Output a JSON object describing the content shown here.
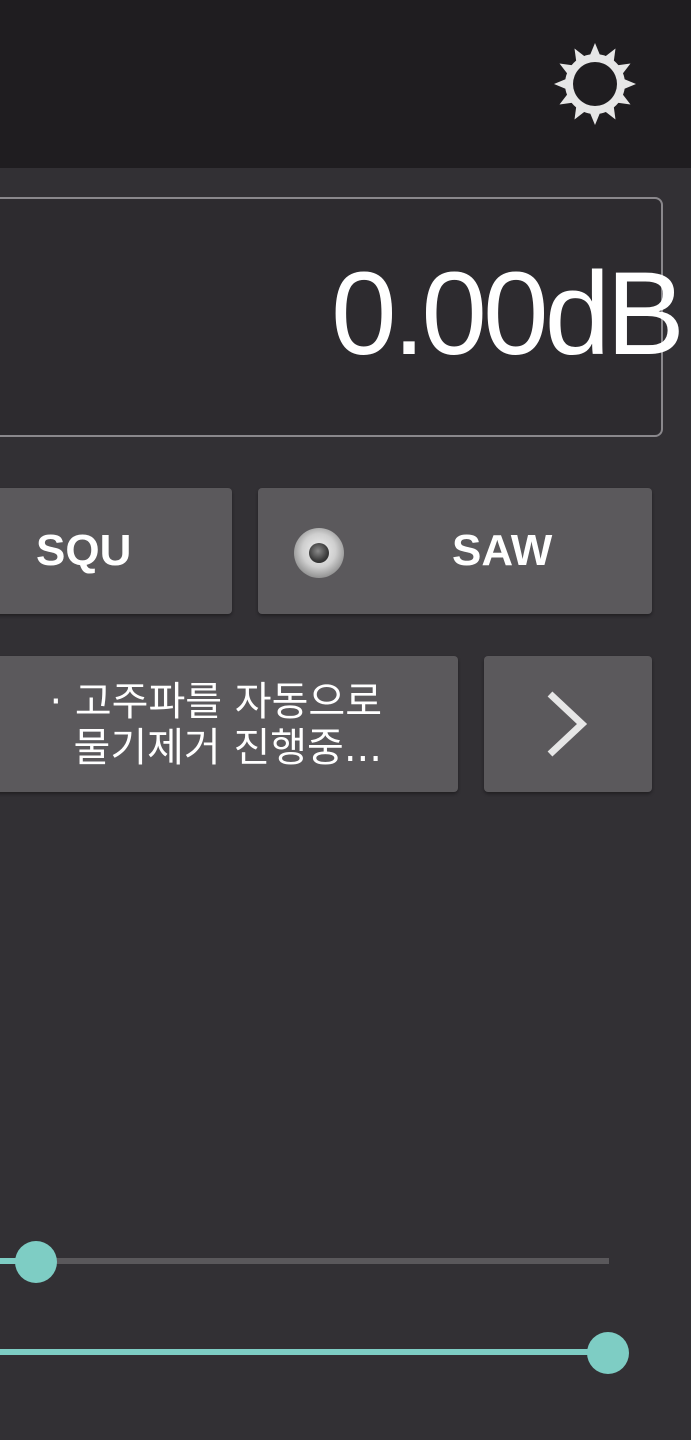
{
  "toolbar": {
    "settings_icon": "gear-icon"
  },
  "display": {
    "level": "0.00dB"
  },
  "waveforms": {
    "squ_label": "SQU",
    "saw_label": "SAW",
    "selected": "SAW"
  },
  "status": {
    "line1": "· 고주파를 자동으로",
    "line2": "물기제거 진행중..."
  },
  "next_button": {
    "icon": "chevron-right-icon"
  },
  "sliders": [
    {
      "value_fraction": 0.06
    },
    {
      "value_fraction": 1.0
    }
  ],
  "colors": {
    "accent": "#7ecdc4",
    "background": "#323034",
    "topbar": "#1f1d20",
    "button": "#5b595c"
  }
}
